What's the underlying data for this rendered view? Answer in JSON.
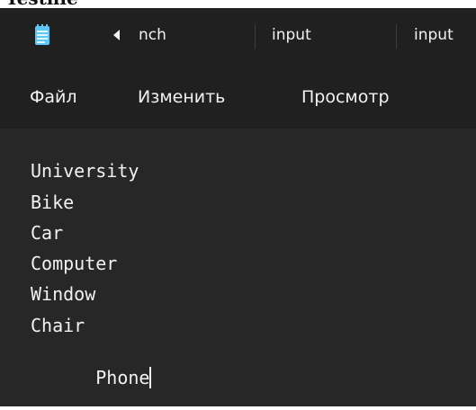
{
  "document_header": {
    "cut_text": "Testfile"
  },
  "window": {
    "tabs": [
      {
        "label": "nch"
      },
      {
        "label": "input"
      },
      {
        "label": "input"
      }
    ]
  },
  "menu": {
    "file": "Файл",
    "edit": "Изменить",
    "view": "Просмотр"
  },
  "editor": {
    "lines": [
      "University",
      "Bike",
      "Car",
      "Computer",
      "Window",
      "Chair",
      "Phone"
    ]
  },
  "colors": {
    "titlebar_bg": "#202020",
    "editor_bg": "#272727",
    "text": "#f2f2f2",
    "icon_accent": "#5bc8f7"
  },
  "icons": {
    "app_icon": "notepad-icon",
    "tab_scroll": "tab-scroll-left-icon"
  }
}
